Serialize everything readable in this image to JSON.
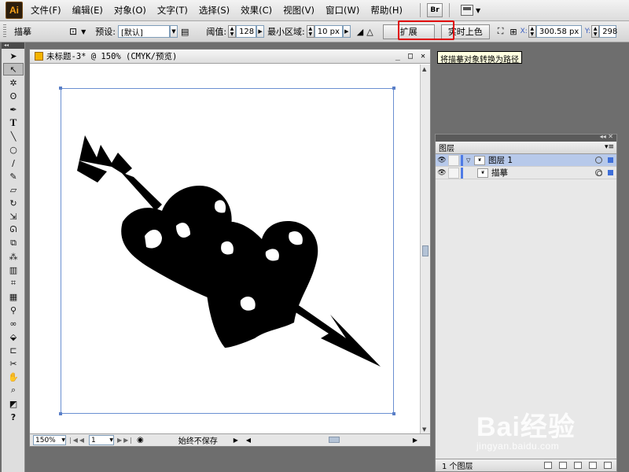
{
  "app": {
    "logo_text": "Ai"
  },
  "menu": {
    "items": [
      "文件(F)",
      "编辑(E)",
      "对象(O)",
      "文字(T)",
      "选择(S)",
      "效果(C)",
      "视图(V)",
      "窗口(W)",
      "帮助(H)"
    ],
    "bridge_label": "Br"
  },
  "control": {
    "object_label": "描摹",
    "preset_label": "预设:",
    "preset_value": "[默认]",
    "threshold_label": "阈值:",
    "threshold_value": "128",
    "min_area_label": "最小区域:",
    "min_area_value": "10 px",
    "expand_label": "扩展",
    "live_paint_label": "实时上色",
    "x_label": "X:",
    "x_value": "300.58 px",
    "y_label": "Y:",
    "y_value": "298"
  },
  "tooltip": {
    "text": "将描摹对象转换为路径"
  },
  "document": {
    "title": "未标题-3* @ 150% (CMYK/预览)",
    "zoom": "150%",
    "page": "1",
    "save_status": "始终不保存"
  },
  "layers": {
    "tab_label": "图层",
    "rows": [
      {
        "name": "图层 1",
        "selected": true
      },
      {
        "name": "描摹",
        "selected": false
      }
    ],
    "footer_count": "1 个图层"
  },
  "watermark": {
    "main": "Bai经验",
    "sub": "jingyan.baidu.com"
  },
  "colors": {
    "highlight_box": "#e00000",
    "selection_blue": "#b7c9ea",
    "artboard_border": "#6a8fd1",
    "workspace_gray": "#6e6e6e"
  },
  "icons": [
    "selection-icon",
    "direct-selection-icon",
    "magic-wand-icon",
    "lasso-icon",
    "pen-icon",
    "type-icon",
    "line-icon",
    "ellipse-icon",
    "paintbrush-icon",
    "pencil-icon",
    "eraser-icon",
    "rotate-icon",
    "scale-icon",
    "warp-icon",
    "free-transform-icon",
    "symbol-sprayer-icon",
    "graph-icon",
    "mesh-icon",
    "gradient-icon",
    "eyedropper-icon",
    "blend-icon",
    "live-paint-icon",
    "crop-icon",
    "slice-icon",
    "hand-icon",
    "zoom-icon"
  ]
}
